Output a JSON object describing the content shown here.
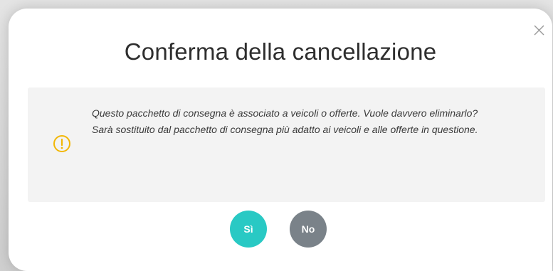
{
  "dialog": {
    "title": "Conferma della cancellazione",
    "message_line1": "Questo pacchetto di consegna è associato a veicoli o offerte. Vuole davvero eliminarlo?",
    "message_line2": "Sarà sostituito dal pacchetto di consegna più adatto ai veicoli e alle offerte in questione.",
    "yes_label": "Sì",
    "no_label": "No",
    "close_icon": "close-icon",
    "warning_icon": "warning-circle-icon"
  },
  "colors": {
    "yes_button": "#29c9c4",
    "no_button": "#7a8289",
    "warning": "#f2b705",
    "message_background": "#f3f3f3"
  }
}
